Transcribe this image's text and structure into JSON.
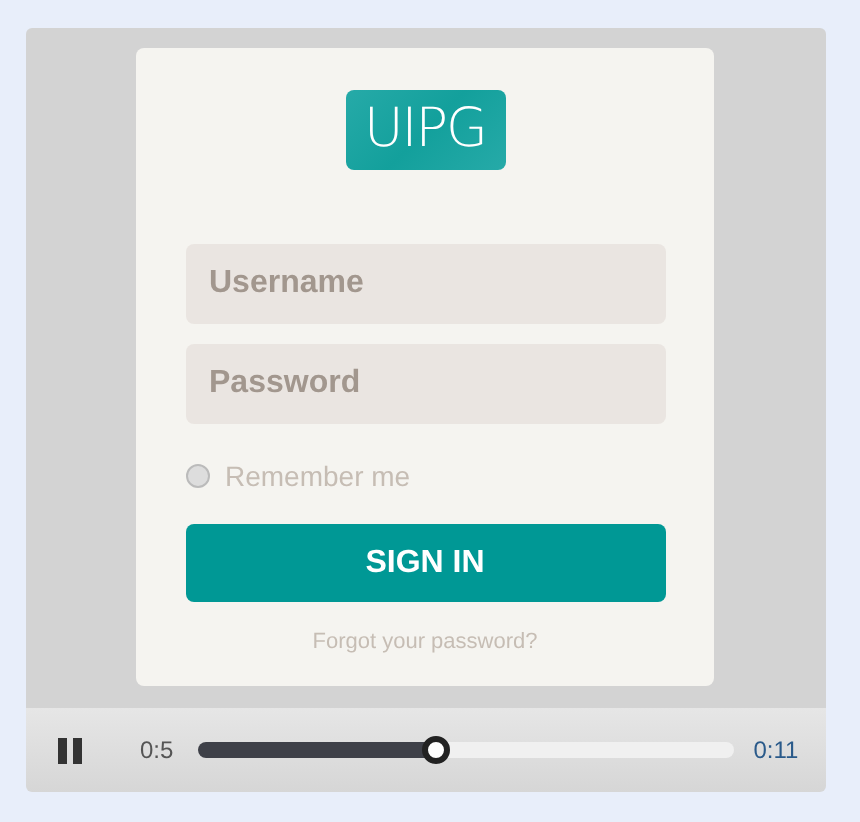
{
  "video": {
    "logo": "UIPG",
    "fields": [
      {
        "placeholder": "Username"
      },
      {
        "placeholder": "Password"
      }
    ],
    "remember": {
      "label": "Remember me",
      "checked": false
    },
    "button": "SIGN IN",
    "forgot": "Forgot your password?"
  },
  "controls": {
    "playing": true,
    "current": "0:5",
    "duration": "0:11",
    "level": 0.44
  }
}
